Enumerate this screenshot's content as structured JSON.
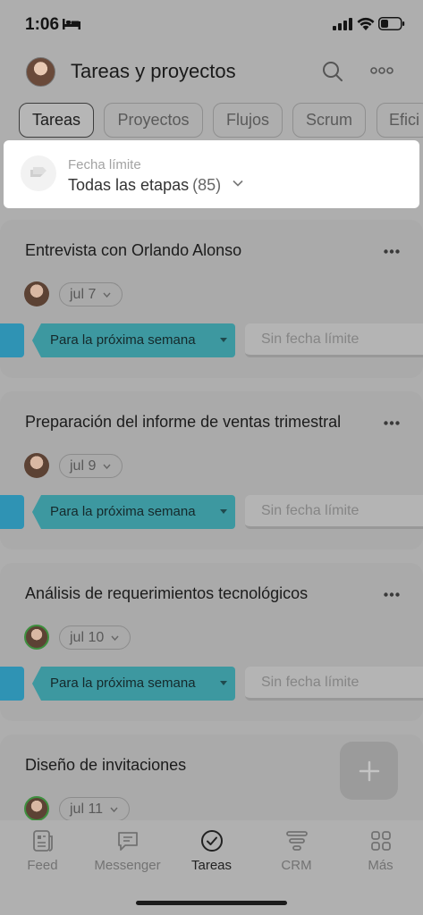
{
  "status_bar": {
    "time": "1:06"
  },
  "header": {
    "title": "Tareas y proyectos"
  },
  "tabs": [
    {
      "label": "Tareas",
      "active": true
    },
    {
      "label": "Proyectos",
      "active": false
    },
    {
      "label": "Flujos",
      "active": false
    },
    {
      "label": "Scrum",
      "active": false
    },
    {
      "label": "Efici",
      "active": false
    }
  ],
  "filter": {
    "label": "Fecha límite",
    "value": "Todas las etapas",
    "count": "(85)"
  },
  "tasks": [
    {
      "title": "Entrevista con Orlando Alonso",
      "date": "jul 7",
      "stage": "Para la próxima semana",
      "next_stage": "Sin fecha límite"
    },
    {
      "title": "Preparación del informe de ventas trimestral",
      "date": "jul 9",
      "stage": "Para la próxima semana",
      "next_stage": "Sin fecha límite"
    },
    {
      "title": "Análisis de requerimientos tecnológicos",
      "date": "jul 10",
      "stage": "Para la próxima semana",
      "next_stage": "Sin fecha límite"
    },
    {
      "title": "Diseño de invitaciones",
      "date": "jul 11"
    }
  ],
  "bottom_nav": [
    {
      "label": "Feed",
      "icon": "feed-icon"
    },
    {
      "label": "Messenger",
      "icon": "messenger-icon"
    },
    {
      "label": "Tareas",
      "icon": "tasks-check-icon",
      "active": true
    },
    {
      "label": "CRM",
      "icon": "crm-icon"
    },
    {
      "label": "Más",
      "icon": "grid-icon"
    }
  ],
  "colors": {
    "stage_active": "#3d98a0",
    "stage_left": "#2f93b4",
    "overlay_background": "#aeaeae"
  }
}
